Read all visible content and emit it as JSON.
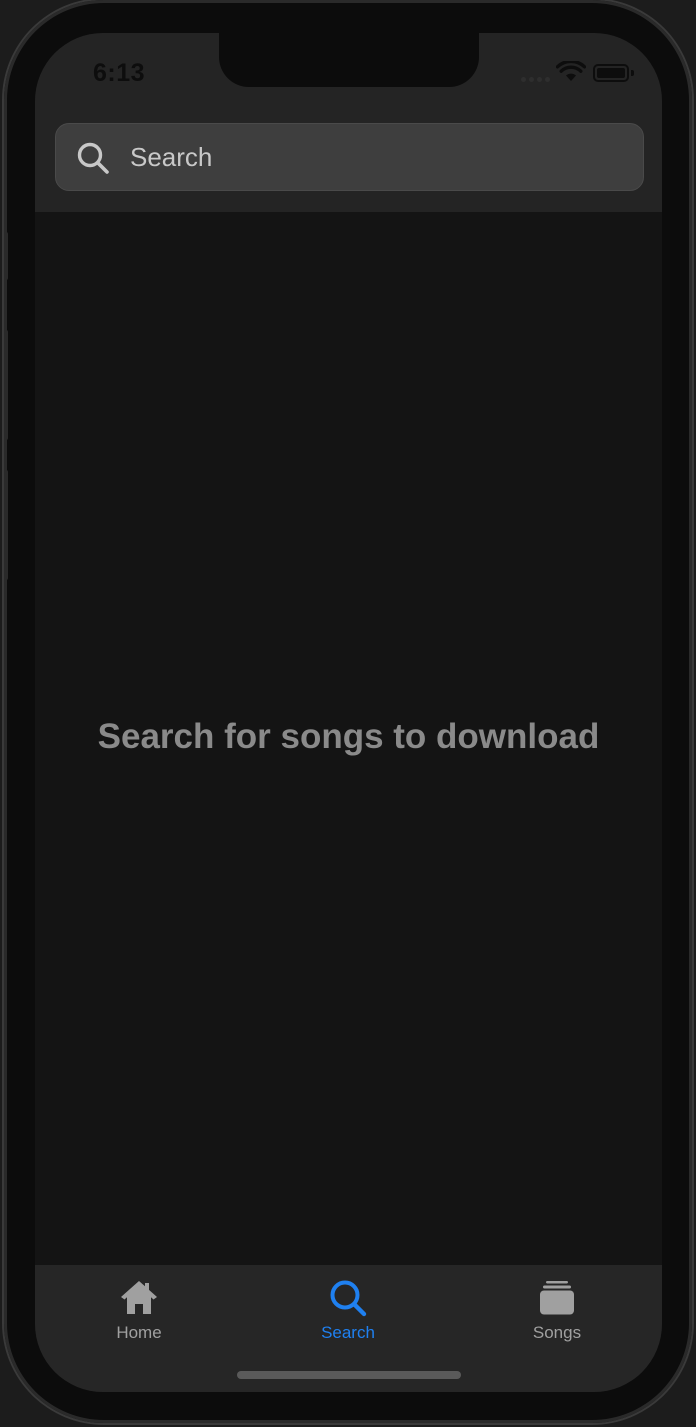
{
  "status_bar": {
    "time": "6:13"
  },
  "search": {
    "placeholder": "Search",
    "value": ""
  },
  "main": {
    "empty_message": "Search for songs to download"
  },
  "tabs": [
    {
      "label": "Home",
      "icon": "house-icon",
      "active": false
    },
    {
      "label": "Search",
      "icon": "magnifying-glass-icon",
      "active": true
    },
    {
      "label": "Songs",
      "icon": "stack-icon",
      "active": false
    }
  ],
  "colors": {
    "accent": "#1f80f0",
    "inactive": "#a0a0a0",
    "background": "#141414",
    "bar_background": "#242424"
  }
}
